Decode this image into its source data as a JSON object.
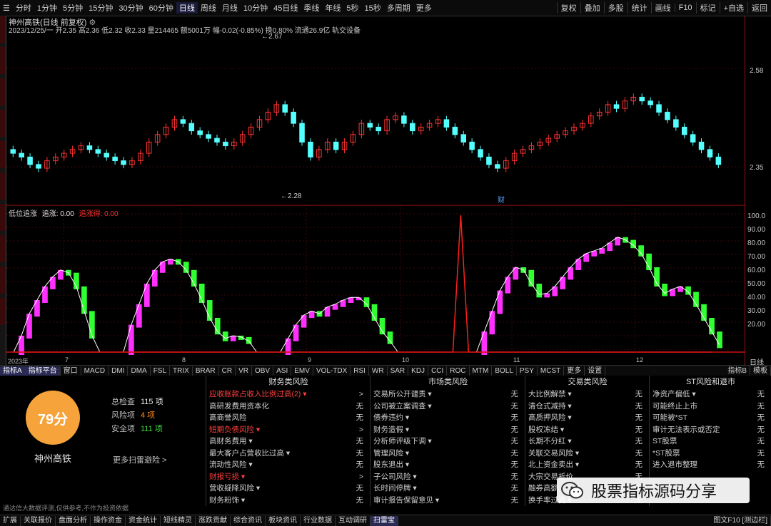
{
  "toolbar": {
    "items": [
      "分时",
      "1分钟",
      "5分钟",
      "15分钟",
      "30分钟",
      "60分钟",
      "日线",
      "周线",
      "月线",
      "10分钟",
      "45日线",
      "季线",
      "年线",
      "5秒",
      "15秒",
      "多周期",
      "更多"
    ],
    "active_index": 6,
    "right_items": [
      "复权",
      "叠加",
      "多股",
      "统计",
      "画线",
      "F10",
      "标记",
      "+自选",
      "返回"
    ]
  },
  "chart": {
    "title": "神州高铁(日线 前复权)",
    "info_date": "2023/12/25/一",
    "info_text": "开2.35 高2.36 低2.32 收2.33 量214465 额5001万 幅-0.02(-0.85%) 换0.80% 流通26.9亿 轨交设备",
    "price_labels": [
      "2.58",
      "2.35"
    ],
    "high_marker": "2.67",
    "low_marker": "2.28",
    "event_marker": "财",
    "colors": {
      "up": "#ff3232",
      "down": "#54ffff",
      "axis": "#9a1010"
    }
  },
  "indicator": {
    "name": "低位追涨",
    "label1": "追涨: 0.00",
    "label2": "追涨得: 0.00",
    "scale_labels": [
      "100.0",
      "80.00",
      "60.00",
      "40.00",
      "20.00"
    ],
    "scale_labels_fine": [
      "100.0",
      "90.00",
      "80.00",
      "70.00",
      "60.00",
      "50.00",
      "40.00",
      "30.00",
      "20.00"
    ],
    "x_labels": [
      "2023年",
      "7",
      "8",
      "9",
      "10",
      "11",
      "12"
    ],
    "axis_right_label": "日线"
  },
  "chart_data": {
    "type": "line",
    "title": "低位追涨",
    "series": [
      {
        "name": "追涨",
        "values": [
          0,
          12,
          28,
          38,
          48,
          55,
          60,
          58,
          48,
          30,
          12,
          0,
          0,
          0,
          0,
          20,
          35,
          50,
          60,
          66,
          68,
          66,
          60,
          50,
          38,
          25,
          15,
          10,
          12,
          11,
          8,
          0,
          0,
          0,
          0,
          10,
          20,
          27,
          30,
          28,
          33,
          35,
          38,
          40,
          40,
          35,
          25,
          15,
          8,
          0,
          0,
          0,
          0,
          0,
          0,
          0,
          0,
          0,
          0,
          0,
          15,
          30,
          45,
          55,
          62,
          60,
          50,
          42,
          43,
          48,
          55,
          62,
          68,
          72,
          74,
          76,
          80,
          84,
          82,
          78,
          72,
          62,
          50,
          43,
          46,
          48,
          44,
          35,
          25,
          15,
          5
        ]
      },
      {
        "name": "追涨得",
        "values": [
          0,
          0,
          0,
          0,
          0,
          0,
          0,
          0,
          0,
          0,
          0,
          0,
          0,
          0,
          0,
          0,
          0,
          0,
          0,
          0,
          0,
          0,
          0,
          0,
          0,
          0,
          0,
          0,
          0,
          0,
          0,
          0,
          0,
          0,
          0,
          0,
          0,
          0,
          0,
          0,
          0,
          0,
          0,
          0,
          0,
          0,
          0,
          0,
          0,
          0,
          0,
          0,
          0,
          0,
          0,
          0,
          0,
          100,
          0,
          0,
          0,
          0,
          0,
          0,
          0,
          0,
          0,
          0,
          0,
          0,
          0,
          0,
          0,
          0,
          0,
          0,
          0,
          0,
          0,
          0,
          0,
          0,
          0,
          0,
          0,
          0,
          0,
          0,
          0,
          0
        ]
      }
    ],
    "ylim": [
      0,
      100
    ]
  },
  "indicator_toolbar": {
    "items": [
      "指标A",
      "指标平台",
      "窗口",
      "MACD",
      "DMI",
      "DMA",
      "FSL",
      "TRIX",
      "BRAR",
      "CR",
      "VR",
      "OBV",
      "ASI",
      "EMV",
      "VOL-TDX",
      "RSI",
      "WR",
      "SAR",
      "KDJ",
      "CCI",
      "ROC",
      "MTM",
      "BOLL",
      "PSY",
      "MCST",
      "更多",
      "设置"
    ],
    "right_items": [
      "指标B",
      "模板"
    ]
  },
  "risk": {
    "score": "79分",
    "stock": "神州高铁",
    "total_label": "总检查",
    "total_value": "115 项",
    "risk_label": "风险项",
    "risk_value": "4 项",
    "safe_label": "安全项",
    "safe_value": "111 项",
    "more": "更多扫雷避险 >",
    "disclaimer": "通达信大数据评测,仅供参考,不作为投资依据",
    "columns": [
      {
        "title": "财务类风险",
        "rows": [
          {
            "label": "应收账款占收入比例过高(2) ▾",
            "status": ">",
            "red": true
          },
          {
            "label": "高研发费用资本化",
            "status": "无",
            "red": false
          },
          {
            "label": "高商誉风险",
            "status": "无",
            "red": false
          },
          {
            "label": "短期负债风险 ▾",
            "status": ">",
            "red": true
          },
          {
            "label": "高财务费用 ▾",
            "status": "无",
            "red": false
          },
          {
            "label": "最大客户占营收比过高 ▾",
            "status": "无",
            "red": false
          },
          {
            "label": "流动性风险 ▾",
            "status": "无",
            "red": false
          },
          {
            "label": "财报亏损 ▾",
            "status": ">",
            "red": true
          },
          {
            "label": "营收疑降风险 ▾",
            "status": "无",
            "red": false
          },
          {
            "label": "财务粉饰 ▾",
            "status": "无",
            "red": false
          }
        ]
      },
      {
        "title": "市场类风险",
        "rows": [
          {
            "label": "交易所公开谴责 ▾",
            "status": "无",
            "red": false
          },
          {
            "label": "公司被立案调查 ▾",
            "status": "无",
            "red": false
          },
          {
            "label": "债券违约 ▾",
            "status": "无",
            "red": false
          },
          {
            "label": "财务造假 ▾",
            "status": "无",
            "red": false
          },
          {
            "label": "分析师评级下调 ▾",
            "status": "无",
            "red": false
          },
          {
            "label": "管理风险 ▾",
            "status": "无",
            "red": false
          },
          {
            "label": "股东退出 ▾",
            "status": "无",
            "red": false
          },
          {
            "label": "子公司风险 ▾",
            "status": "无",
            "red": false
          },
          {
            "label": "长时间停牌 ▾",
            "status": "无",
            "red": false
          },
          {
            "label": "审计报告保留意见 ▾",
            "status": "无",
            "red": false
          }
        ]
      },
      {
        "title": "交易类风险",
        "rows": [
          {
            "label": "大比例解禁 ▾",
            "status": "无",
            "red": false
          },
          {
            "label": "清仓式减持 ▾",
            "status": "无",
            "red": false
          },
          {
            "label": "高质押风险 ▾",
            "status": "无",
            "red": false
          },
          {
            "label": "股权冻结 ▾",
            "status": "无",
            "red": false
          },
          {
            "label": "长期不分红 ▾",
            "status": "无",
            "red": false
          },
          {
            "label": "关联交易风险 ▾",
            "status": "无",
            "red": false
          },
          {
            "label": "北上资金卖出 ▾",
            "status": "无",
            "red": false
          },
          {
            "label": "大宗交易折价",
            "status": "无",
            "red": false
          },
          {
            "label": "融券高额",
            "status": "无",
            "red": false
          },
          {
            "label": "换手率过高 ▾",
            "status": "无",
            "red": false
          }
        ]
      },
      {
        "title": "ST风险和退市",
        "rows": [
          {
            "label": "净资产偏低 ▾",
            "status": "无",
            "red": false
          },
          {
            "label": "可能终止上市",
            "status": "无",
            "red": false
          },
          {
            "label": "可能被*ST",
            "status": "无",
            "red": false
          },
          {
            "label": "审计无法表示或否定",
            "status": "无",
            "red": false
          },
          {
            "label": "ST股票",
            "status": "无",
            "red": false
          },
          {
            "label": "*ST股票",
            "status": "无",
            "red": false
          },
          {
            "label": "进入退市整理",
            "status": "无",
            "red": false
          }
        ]
      }
    ]
  },
  "bottom_tabs": {
    "items": [
      "扩展",
      "关联报价",
      "盘面分析",
      "操作资金",
      "资金统计",
      "短线精灵",
      "涨跌贡献",
      "综合资讯",
      "板块资讯",
      "行业数据",
      "互动调研",
      "扫雷宝"
    ],
    "active_index": 11,
    "right_label": "图文F10 [测边栏]"
  },
  "watermark": {
    "text": "股票指标源码分享"
  }
}
